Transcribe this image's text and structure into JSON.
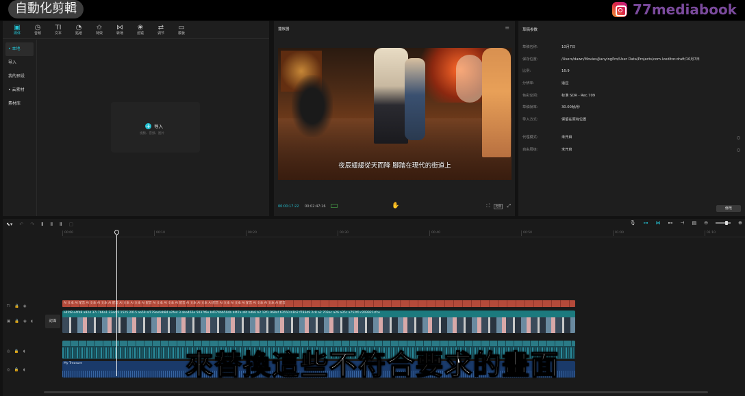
{
  "banner": {
    "title": "自動化剪輯",
    "channel": "77mediabook"
  },
  "media": {
    "tools": [
      {
        "icon": "▣",
        "label": "媒体"
      },
      {
        "icon": "◷",
        "label": "音频"
      },
      {
        "icon": "TI",
        "label": "文本"
      },
      {
        "icon": "◔",
        "label": "贴纸"
      },
      {
        "icon": "✩",
        "label": "特效"
      },
      {
        "icon": "⋈",
        "label": "转场"
      },
      {
        "icon": "❀",
        "label": "滤镜"
      },
      {
        "icon": "⇄",
        "label": "调节"
      },
      {
        "icon": "▭",
        "label": "模板"
      }
    ],
    "sidebar": [
      "• 本地",
      "导入",
      "我的预设",
      "• 云素材",
      "素材库"
    ],
    "import_label": "导入",
    "import_hint": "视频、音频、图片"
  },
  "player": {
    "title": "播放器",
    "subtitle": "夜辰緩緩從天而降 腳踏在現代的街道上",
    "time_current": "00:00:17:22",
    "time_total": "00:02:47:16",
    "ratio_label": "比例"
  },
  "props": {
    "title": "草稿参数",
    "rows": [
      {
        "k": "草稿名称:",
        "v": "10月7日"
      },
      {
        "k": "保存位置:",
        "v": "/Users/dawn/Movies/JianyingPro/User Data/Projects/com.lveditor.draft/10月7日"
      },
      {
        "k": "比例:",
        "v": "16:9"
      },
      {
        "k": "分辨率:",
        "v": "适应"
      },
      {
        "k": "色彩空间:",
        "v": "标准 SDR - Rec.709"
      },
      {
        "k": "草稿帧率:",
        "v": "30.00帧/秒"
      },
      {
        "k": "导入方式:",
        "v": "保留在原有位置"
      },
      {
        "k": "代理模式:",
        "v": "未开启"
      },
      {
        "k": "自由层级:",
        "v": "未开启"
      }
    ],
    "modify_label": "修改"
  },
  "timeline": {
    "ticks": [
      "00:00",
      "00:10",
      "00:20",
      "00:30",
      "00:40",
      "00:50",
      "01:00",
      "01:10",
      "01:20"
    ],
    "cover_label": "封面",
    "text_track_label": "AI 文本 AI 配音 AI 文本 AI 文本 AI 配音 AI 文本 AI 文本 AI 配音 AI 文本 AI 文本 AI 配音 AI 文本 AI 文本 AI 配音 AI 文本 AI 文本 AI 配音 AI 文本 AI 文本 AI 配音",
    "video_track_label": "e4fd8  e4fd8  a924  37i  7b6a1  33ed  5  1525  2015  aa59  af179eefeb84  a2fe4  3  dea462e  5037f6e  b4174bb50db  bf47a  afd  bdb6  b2  12f1  968af  63550  b1b2  f783d9  2c8  a2  703ec  a26  a35c  a752f0  c203921cfce",
    "audio_label": "My Treasure"
  },
  "caption": "來替換這些不符合要求的畫面"
}
